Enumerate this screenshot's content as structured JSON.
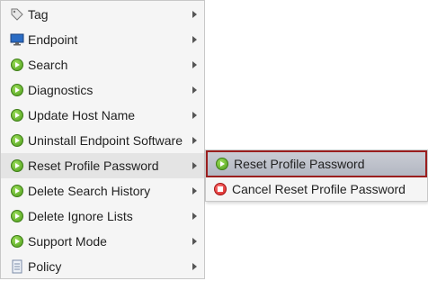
{
  "menu": {
    "items": [
      {
        "label": "Tag",
        "icon": "tag-icon"
      },
      {
        "label": "Endpoint",
        "icon": "monitor-icon"
      },
      {
        "label": "Search",
        "icon": "play-icon"
      },
      {
        "label": "Diagnostics",
        "icon": "play-icon"
      },
      {
        "label": "Update Host Name",
        "icon": "play-icon"
      },
      {
        "label": "Uninstall Endpoint Software",
        "icon": "play-icon"
      },
      {
        "label": "Reset Profile Password",
        "icon": "play-icon"
      },
      {
        "label": "Delete Search History",
        "icon": "play-icon"
      },
      {
        "label": "Delete Ignore Lists",
        "icon": "play-icon"
      },
      {
        "label": "Support Mode",
        "icon": "play-icon"
      },
      {
        "label": "Policy",
        "icon": "document-icon"
      }
    ]
  },
  "submenu": {
    "items": [
      {
        "label": "Reset Profile Password",
        "icon": "play-icon"
      },
      {
        "label": "Cancel Reset Profile Password",
        "icon": "stop-icon"
      }
    ]
  },
  "colors": {
    "selected_border": "#9a1e1e",
    "play_green": "#4a9a1a",
    "stop_red": "#d21f1f"
  }
}
